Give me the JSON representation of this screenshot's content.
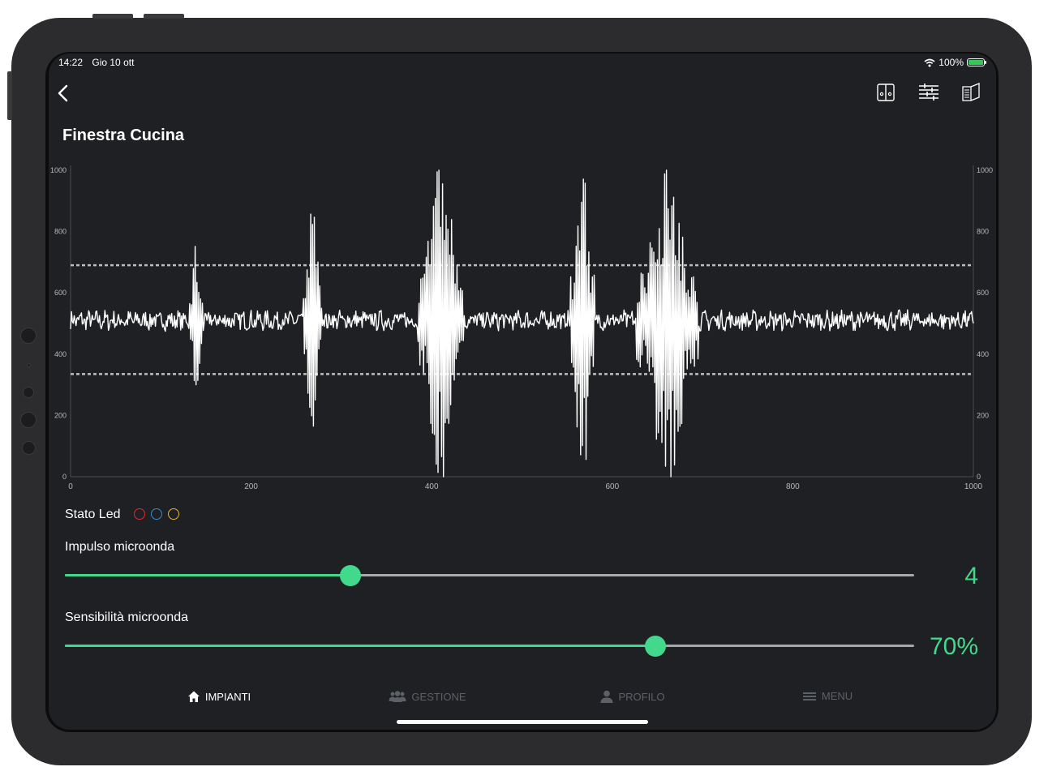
{
  "status_bar": {
    "time": "14:22",
    "date": "Gio 10 ott",
    "battery": "100%"
  },
  "header": {
    "back_icon": "chevron-left-icon",
    "actions": [
      "split-view-icon",
      "sliders-icon",
      "book-icon"
    ]
  },
  "page": {
    "title": "Finestra Cucina"
  },
  "chart_data": {
    "type": "line",
    "x_ticks": [
      0,
      200,
      400,
      600,
      800,
      1000
    ],
    "y_ticks": [
      0,
      200,
      400,
      600,
      800,
      1000
    ],
    "xlim": [
      0,
      1000
    ],
    "ylim": [
      0,
      1000
    ],
    "thresholds": [
      690,
      335
    ],
    "baseline": 510,
    "noise_amplitude": 28,
    "bursts": [
      {
        "center": 139,
        "width": 18,
        "min": 300,
        "max": 840
      },
      {
        "center": 268,
        "width": 22,
        "min": 165,
        "max": 910
      },
      {
        "center": 410,
        "width": 52,
        "min": 0,
        "max": 1000
      },
      {
        "center": 567,
        "width": 28,
        "min": 0,
        "max": 1000
      },
      {
        "center": 661,
        "width": 70,
        "min": 0,
        "max": 1000
      }
    ],
    "line_color": "#ffffff",
    "threshold_color": "#bdbdbd",
    "grid": false,
    "legend": "none"
  },
  "led_status": {
    "label": "Stato Led",
    "colors": [
      "#e02b2b",
      "#2f8fd8",
      "#e3b52a"
    ]
  },
  "sliders": [
    {
      "label": "Impulso microonda",
      "value": 0.336,
      "display": "4"
    },
    {
      "label": "Sensibilità microonda",
      "value": 0.695,
      "display": "70%"
    }
  ],
  "tabs": [
    {
      "label": "IMPIANTI",
      "icon": "home-icon",
      "active": true
    },
    {
      "label": "GESTIONE",
      "icon": "users-icon",
      "active": false
    },
    {
      "label": "PROFILO",
      "icon": "user-icon",
      "active": false
    },
    {
      "label": "MENU",
      "icon": "menu-icon",
      "active": false
    }
  ],
  "colors": {
    "accent": "#43d98c",
    "background": "#1f2023",
    "inactive_tab": "#5d6066"
  }
}
